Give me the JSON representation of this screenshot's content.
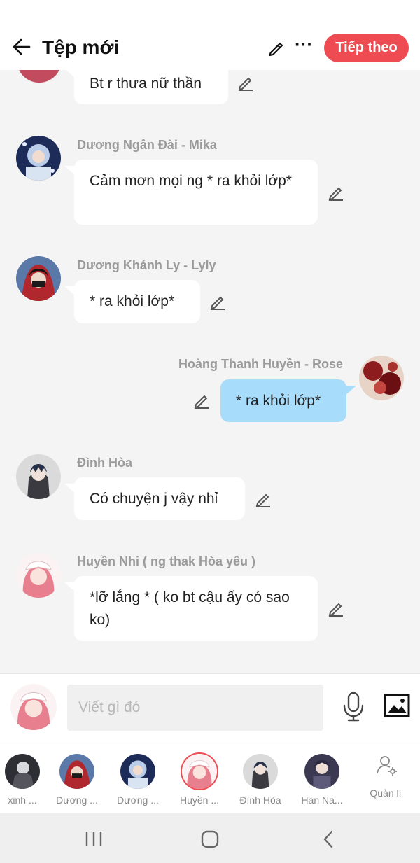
{
  "header": {
    "title": "Tệp mới",
    "next_label": "Tiếp theo",
    "more_label": "···"
  },
  "messages": [
    {
      "sender": "",
      "text": "Bt r thưa nữ thần",
      "side": "left"
    },
    {
      "sender": "Dương Ngân Đài - Mika",
      "text": "Cảm mơn mọi ng * ra khỏi lớp*",
      "side": "left"
    },
    {
      "sender": "Dương Khánh Ly - Lyly",
      "text": "* ra khỏi lớp*",
      "side": "left"
    },
    {
      "sender": "Hoàng Thanh Huyền - Rose",
      "text": "* ra khỏi lớp*",
      "side": "right"
    },
    {
      "sender": "Đình Hòa",
      "text": "Có chuyện j vậy nhỉ",
      "side": "left"
    },
    {
      "sender": "Huyền Nhi ( ng thak Hòa yêu )",
      "text": "*lỡ lắng * ( ko bt cậu ấy có sao ko)",
      "side": "left"
    }
  ],
  "composer": {
    "placeholder": "Viết gì đó"
  },
  "characters": [
    {
      "name": "xinh ..."
    },
    {
      "name": "Dương ..."
    },
    {
      "name": "Dương ..."
    },
    {
      "name": "Huyền ...",
      "selected": true
    },
    {
      "name": "Đình Hòa"
    },
    {
      "name": "Hàn Na..."
    }
  ],
  "manage_label": "Quản lí",
  "colors": {
    "accent": "#ef4b52",
    "my_bubble": "#a8dcfb",
    "other_bubble": "#ffffff",
    "background": "#f4f4f4"
  }
}
